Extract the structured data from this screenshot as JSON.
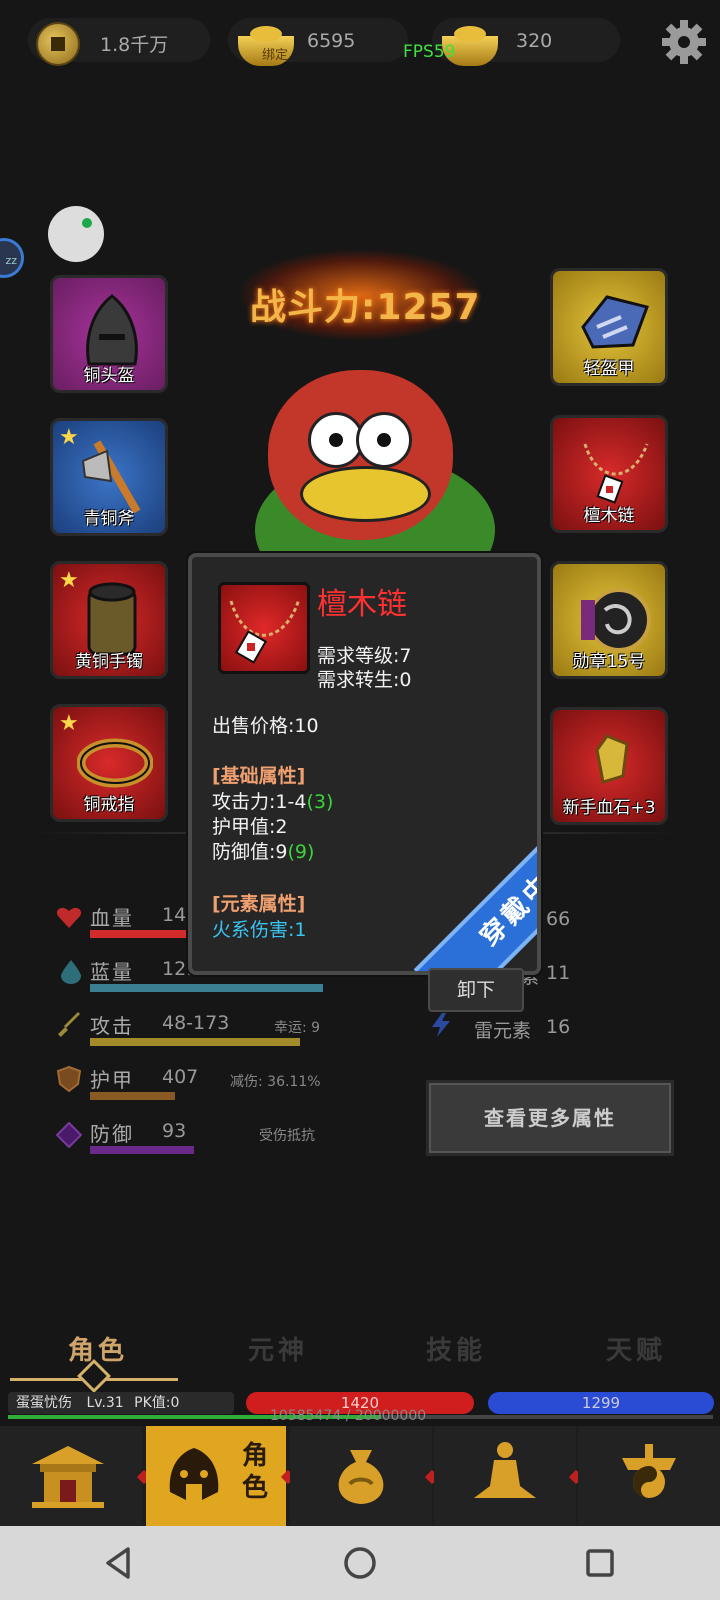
{
  "top_bar": {
    "copper_coins": "1.8千万",
    "bound_gold_badge": "绑定",
    "bound_gold": "6595",
    "fps": "FPS59",
    "gold": "320"
  },
  "float_badge": "zz",
  "combat_power": "战斗力:1257",
  "equipment": {
    "left": [
      {
        "label": "铜头盔",
        "rarity": "purple",
        "star": false
      },
      {
        "label": "青铜斧",
        "rarity": "blue",
        "star": true
      },
      {
        "label": "黄铜手镯",
        "rarity": "red",
        "star": true
      },
      {
        "label": "铜戒指",
        "rarity": "red",
        "star": true
      }
    ],
    "right": [
      {
        "label": "轻盔甲",
        "rarity": "gold",
        "star": false
      },
      {
        "label": "檀木链",
        "rarity": "red",
        "star": false
      },
      {
        "label": "勋章15号",
        "rarity": "gold",
        "star": false
      },
      {
        "label": "新手血石+3",
        "rarity": "red",
        "star": false
      }
    ],
    "star_symbol": "★"
  },
  "stats": {
    "hp": {
      "label": "血量",
      "value": "14",
      "icon": "heart-icon",
      "color": "#d32a2a"
    },
    "mp": {
      "label": "蓝量",
      "value": "1299",
      "icon": "drop-icon",
      "color": "#3a7f92"
    },
    "attack": {
      "label": "攻击",
      "value": "48-173",
      "note": "幸运: 9",
      "icon": "sword-icon",
      "color": "#a38a2a"
    },
    "armor": {
      "label": "护甲",
      "value": "407",
      "note": "减伤: 36.11%",
      "icon": "shield-icon",
      "color": "#8a5a24"
    },
    "defense": {
      "label": "防御",
      "value": "93",
      "note": "受伤抵抗",
      "icon": "defense-icon",
      "color": "#6a2a8a"
    }
  },
  "right_stats": {
    "row1_value": "66",
    "row2_label": "素",
    "row2_value": "11",
    "thunder_label": "雷元素",
    "thunder_value": "16"
  },
  "more_attributes_button": "查看更多属性",
  "popup": {
    "title": "檀木链",
    "req_level": "需求等级:7",
    "req_rebirth": "需求转生:0",
    "sell_price": "出售价格:10",
    "base_header": "[基础属性]",
    "attack": "攻击力:1-4",
    "attack_bonus": "(3)",
    "armor": "护甲值:2",
    "defense": "防御值:9",
    "defense_bonus": "(9)",
    "element_header": "[元素属性]",
    "fire_damage": "火系伤害:1",
    "equipped_ribbon": "穿戴中",
    "unequip_button": "卸下"
  },
  "tabs": [
    "角色",
    "元神",
    "技能",
    "天赋"
  ],
  "active_tab": 0,
  "player": {
    "name": "蛋蛋忧伤",
    "level": "Lv.31",
    "pk": "PK值:0",
    "hp": "1420",
    "mp": "1299",
    "exp": "10585474 / 20000000",
    "exp_ratio": 0.529
  },
  "bottom_nav": {
    "active_label": "角色"
  },
  "colors": {
    "accent_gold": "#e0a620",
    "hp_red": "#d01d1d",
    "mp_blue": "#2a4bd4",
    "title_red": "#ff3030"
  }
}
